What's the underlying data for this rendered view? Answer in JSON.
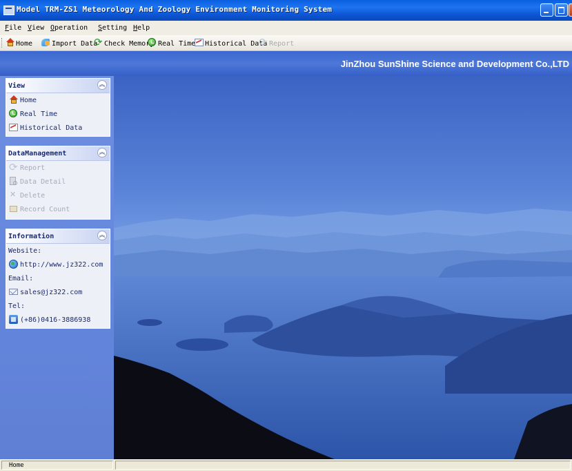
{
  "window": {
    "title": "Model TRM-ZS1 Meteorology And Zoology Environment Monitoring System"
  },
  "menu": [
    "File",
    "View",
    "Operation",
    "Setting",
    "Help"
  ],
  "toolbar": [
    {
      "label": "Home",
      "icon": "home-icon",
      "enabled": true
    },
    {
      "label": "Import Data",
      "icon": "import-icon",
      "enabled": true
    },
    {
      "label": "Check Memory",
      "icon": "refresh-icon",
      "enabled": true
    },
    {
      "label": "Real Time",
      "icon": "clock-icon",
      "enabled": true
    },
    {
      "label": "Historical Data",
      "icon": "chart-icon",
      "enabled": true
    },
    {
      "label": "Report",
      "icon": "report-icon",
      "enabled": false
    }
  ],
  "banner": {
    "company": "JinZhou SunShine Science and Development Co.,LTD"
  },
  "sidebar": {
    "view": {
      "title": "View",
      "items": [
        {
          "label": "Home",
          "icon": "home-icon",
          "enabled": true
        },
        {
          "label": "Real Time",
          "icon": "clock-icon",
          "enabled": true
        },
        {
          "label": "Historical Data",
          "icon": "chart-icon",
          "enabled": true
        }
      ]
    },
    "data_management": {
      "title": "DataManagement",
      "items": [
        {
          "label": "Report",
          "icon": "report-icon",
          "enabled": false
        },
        {
          "label": "Data Detail",
          "icon": "detail-icon",
          "enabled": false
        },
        {
          "label": "Delete",
          "icon": "delete-icon",
          "enabled": false
        },
        {
          "label": "Record Count",
          "icon": "count-icon",
          "enabled": false
        }
      ]
    },
    "information": {
      "title": "Information",
      "website_label": "Website:",
      "website": "http://www.jz322.com",
      "email_label": "Email:",
      "email": "sales@jz322.com",
      "tel_label": "Tel:",
      "tel": "(+86)0416-3886938"
    }
  },
  "status": {
    "text": "Home"
  },
  "colors": {
    "titlebar": "#0a5fe0",
    "banner": "#4d78d8",
    "sidebar": "#6386dc",
    "panel": "#eef0f8"
  }
}
